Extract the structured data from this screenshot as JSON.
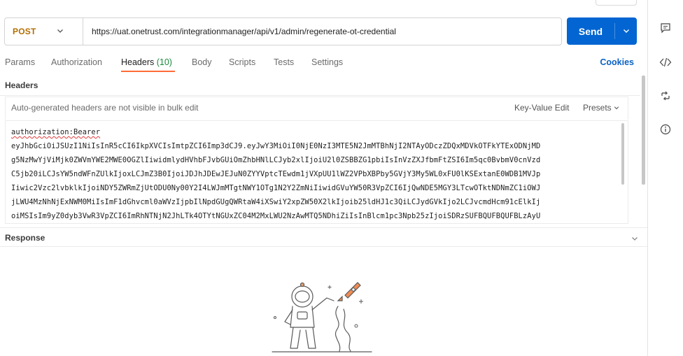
{
  "request": {
    "method": "POST",
    "url": "https://uat.onetrust.com/integrationmanager/api/v1/admin/regenerate-ot-credential",
    "send_label": "Send"
  },
  "tabs": [
    {
      "label": "Params"
    },
    {
      "label": "Authorization"
    },
    {
      "label": "Headers",
      "count": "(10)"
    },
    {
      "label": "Body"
    },
    {
      "label": "Scripts"
    },
    {
      "label": "Tests"
    },
    {
      "label": "Settings"
    }
  ],
  "cookies_label": "Cookies",
  "headers_section": {
    "title": "Headers",
    "bulk_note": "Auto-generated headers are not visible in bulk edit",
    "key_value_edit": "Key-Value Edit",
    "presets": "Presets"
  },
  "bulk_editor": {
    "lines": [
      "authorization:Bearer",
      "eyJhbGciOiJSUzI1NiIsInR5cCI6IkpXVCIsImtpZCI6Imp3dCJ9.eyJwY3MiOiI0NjE0NzI3MTE5N2JmMTBhNjI2NTAyODczZDQxMDVkOTFkYTExODNjMD",
      "g5NzMwYjViMjk0ZWVmYWE2MWE0OGZlIiwidmlydHVhbFJvbGUiOmZhbHNlLCJyb2xlIjoiU2l0ZSBBZG1pbiIsInVzZXJfbmFtZSI6Im5qc0BvbmV0cnVzd",
      "C5jb20iLCJsYW5ndWFnZUlkIjoxLCJmZ3B0IjoiJDJhJDEwJEJuN0ZYYVptcTEwdm1jVXpUU1lWZ2VPbXBPby5GVjY3My5WL0xFU0lKSExtanE0WDB1MVJp",
      "Iiwic2Vzc2lvbklkIjoiNDY5ZWRmZjUtODU0Ny00Y2I4LWJmMTgtNWY1OTg1N2Y2ZmNiIiwidGVuYW50R3VpZCI6IjQwNDE5MGY3LTcwOTktNDNmZC1iOWJ",
      "jLWU4MzNhNjExNWM0MiIsImF1dGhvcml0aWVzIjpbIlNpdGUgQWRtaW4iXSwiY2xpZW50X2lkIjoib25ldHJ1c3QiLCJydGVkIjo2LCJvcmdHcm91cElkIj",
      "oiMSIsIm9yZ0dyb3VwR3VpZCI6ImRhNTNjN2JhLTk4OTYtNGUxZC04M2MxLWU2NzAwMTQ5NDhiZiIsInBlcm1pc3Npb25zIjoiSDRzSUFBQUFBQUFBLzAyU"
    ]
  },
  "response_section": {
    "title": "Response"
  },
  "icons": {
    "method_chevron": "chevron-down-icon",
    "send_dropdown": "chevron-down-icon",
    "presets_chevron": "chevron-down-icon",
    "response_chevron": "chevron-down-icon",
    "rail": [
      "comment-icon",
      "code-icon",
      "related-icon",
      "info-icon"
    ],
    "illustration": "astronaut-rocket-icon"
  },
  "colors": {
    "method": "#b16f00",
    "send": "#0265d2",
    "active_tab_underline": "#ff6c37",
    "header_count": "#1a8a3a",
    "cookies": "#0b62c2",
    "spellcheck": "#e03b3b"
  }
}
